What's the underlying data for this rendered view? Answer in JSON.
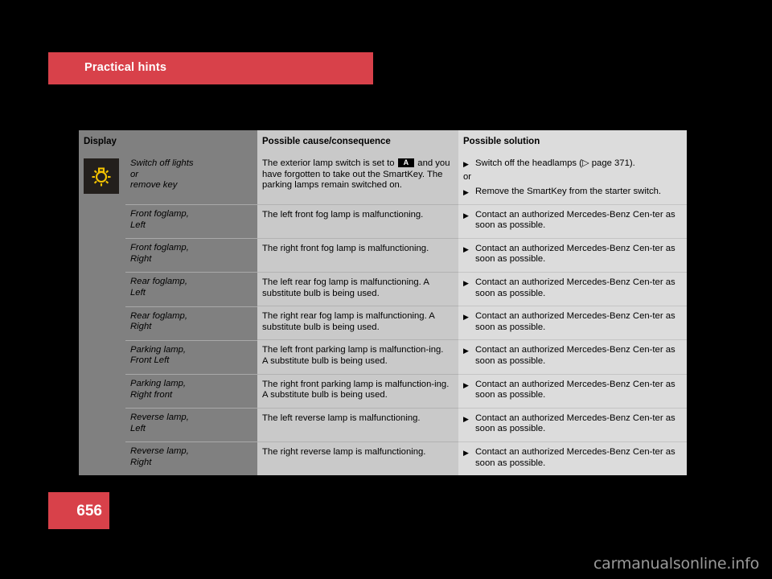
{
  "chapter": {
    "title": "Practical hints"
  },
  "page": {
    "number": "656"
  },
  "watermark": {
    "text": "carmanualsonline.info"
  },
  "table": {
    "headers": {
      "display": "Display",
      "cause": "Possible cause/consequence",
      "solution": "Possible solution"
    },
    "rows": [
      {
        "icon": "lamp-warning-icon",
        "display_lines": [
          "Switch off lights",
          "or",
          "remove key"
        ],
        "cause_parts": {
          "before_badge": "The exterior lamp switch is set to ",
          "badge": "A",
          "after_badge": " and you have forgotten to take out the SmartKey. The parking lamps remain switched on."
        },
        "solutions": [
          "Switch off the headlamps (▷ page 371).",
          "Remove the SmartKey from the starter switch."
        ],
        "solution_connector": "or"
      },
      {
        "display_lines": [
          "Front foglamp,",
          "Left"
        ],
        "cause": "The left front fog lamp is malfunctioning.",
        "solutions": [
          "Contact an authorized Mercedes-Benz Cen-ter as soon as possible."
        ]
      },
      {
        "display_lines": [
          "Front foglamp,",
          "Right"
        ],
        "cause": "The right front fog lamp is malfunctioning.",
        "solutions": [
          "Contact an authorized Mercedes-Benz Cen-ter as soon as possible."
        ]
      },
      {
        "display_lines": [
          "Rear foglamp,",
          "Left"
        ],
        "cause": "The left rear fog lamp is malfunctioning. A substitute bulb is being used.",
        "solutions": [
          "Contact an authorized Mercedes-Benz Cen-ter as soon as possible."
        ]
      },
      {
        "display_lines": [
          "Rear foglamp,",
          "Right"
        ],
        "cause": "The right rear fog lamp is malfunctioning. A substitute bulb is being used.",
        "solutions": [
          "Contact an authorized Mercedes-Benz Cen-ter as soon as possible."
        ]
      },
      {
        "display_lines": [
          "Parking lamp,",
          "Front Left"
        ],
        "cause": "The left front parking lamp is malfunction-ing. A substitute bulb is being used.",
        "solutions": [
          "Contact an authorized Mercedes-Benz Cen-ter as soon as possible."
        ]
      },
      {
        "display_lines": [
          "Parking lamp,",
          "Right front"
        ],
        "cause": "The right front parking lamp is malfunction-ing. A substitute bulb is being used.",
        "solutions": [
          "Contact an authorized Mercedes-Benz Cen-ter as soon as possible."
        ]
      },
      {
        "display_lines": [
          "Reverse lamp,",
          "Left"
        ],
        "cause": "The left reverse lamp is malfunctioning.",
        "solutions": [
          "Contact an authorized Mercedes-Benz Cen-ter as soon as possible."
        ]
      },
      {
        "display_lines": [
          "Reverse lamp,",
          "Right"
        ],
        "cause": "The right reverse lamp is malfunctioning.",
        "solutions": [
          "Contact an authorized Mercedes-Benz Cen-ter as soon as possible."
        ]
      }
    ]
  },
  "colors": {
    "accent_red": "#d8414a",
    "display_text_yellow": "#f5c518",
    "col1_bg": "#808080",
    "col2_bg": "#c9c9c9",
    "col3_bg": "#dcdcdc",
    "page_bg": "#000000"
  }
}
